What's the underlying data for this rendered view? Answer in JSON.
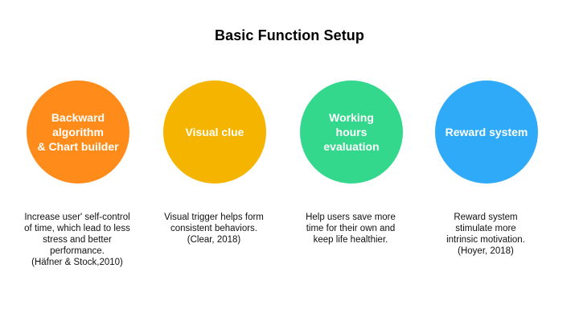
{
  "title": "Basic Function Setup",
  "cards": [
    {
      "label": "Backward\nalgorithm\n& Chart builder",
      "color": "#FF8C1A",
      "description": "Increase user' self-control\nof time, which lead to less\nstress and better\nperformance.\n(Häfner & Stock,2010)"
    },
    {
      "label": "Visual clue",
      "color": "#F5B400",
      "description": "Visual trigger helps form\nconsistent behaviors.\n(Clear, 2018)"
    },
    {
      "label": "Working\nhours\nevaluation",
      "color": "#34D88C",
      "description": "Help users save more\ntime for their own and\nkeep life healthier."
    },
    {
      "label": "Reward system",
      "color": "#2EAAF8",
      "description": "Reward system\nstimulate more\nintrinsic motivation.\n(Hoyer, 2018)"
    }
  ]
}
